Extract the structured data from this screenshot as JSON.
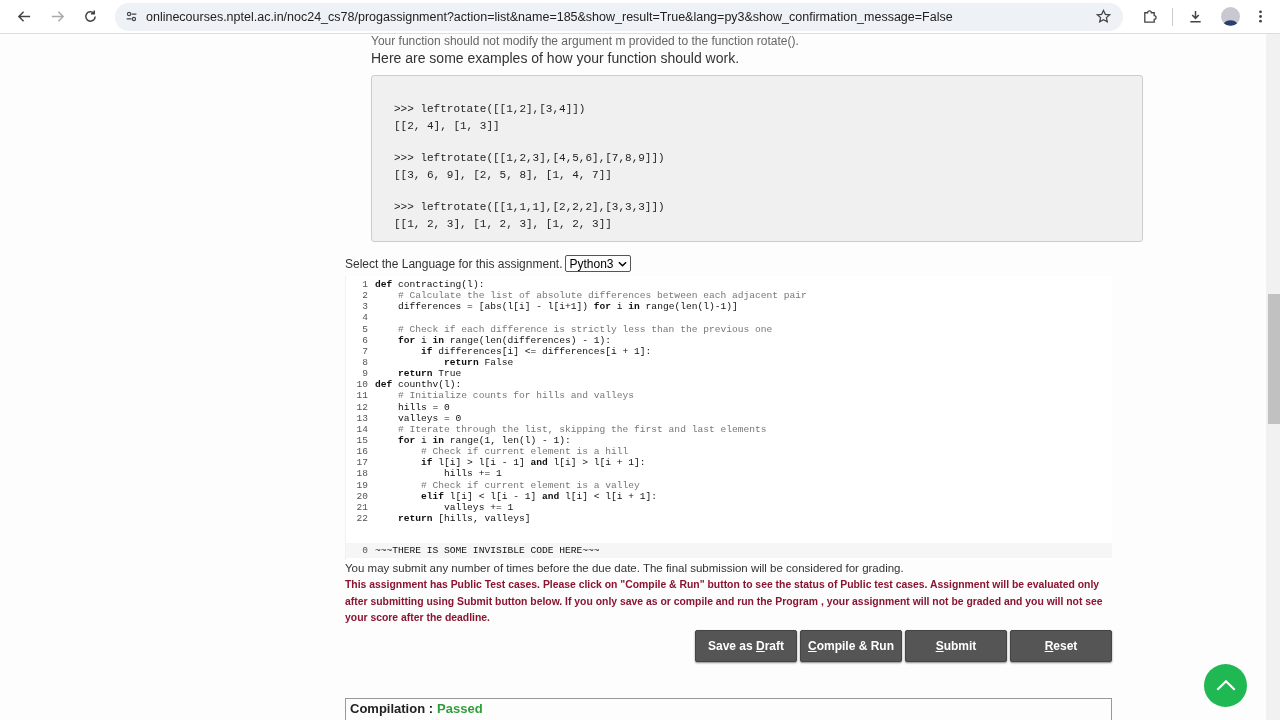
{
  "browser": {
    "url": "onlinecourses.nptel.ac.in/noc24_cs78/progassignment?action=list&name=185&show_result=True&lang=py3&show_confirmation_message=False"
  },
  "intro": "Your function should not modify the argument m provided to the function rotate().",
  "examples_heading": "Here are some examples of how your function should work.",
  "examples": [
    {
      "call": ">>> leftrotate([[1,2],[3,4]])",
      "result": "[[2, 4], [1, 3]]"
    },
    {
      "call": ">>> leftrotate([[1,2,3],[4,5,6],[7,8,9]])",
      "result": "[[3, 6, 9], [2, 5, 8], [1, 4, 7]]"
    },
    {
      "call": ">>> leftrotate([[1,1,1],[2,2,2],[3,3,3]])",
      "result": "[[1, 2, 3], [1, 2, 3], [1, 2, 3]]"
    }
  ],
  "language": {
    "label": "Select the Language for this assignment.",
    "value": "Python3"
  },
  "editor": {
    "lines": [
      {
        "number": "1",
        "kind": "code",
        "code": "**def** contracting(l):"
      },
      {
        "number": "2",
        "kind": "comment",
        "code": "    # Calculate the list of absolute differences between each adjacent pair"
      },
      {
        "number": "3",
        "kind": "code",
        "code": "    differences = [abs(l[i] - l[i+1]) **for** i **in** range(len(l)-1)]"
      },
      {
        "number": "4",
        "kind": "blank"
      },
      {
        "number": "5",
        "kind": "comment",
        "code": "    # Check if each difference is strictly less than the previous one"
      },
      {
        "number": "6",
        "kind": "code",
        "code": "    **for** i **in** range(len(differences) - 1):"
      },
      {
        "number": "7",
        "kind": "code",
        "code": "        **if** differences[i] <= differences[i + 1]:"
      },
      {
        "number": "8",
        "kind": "code",
        "code": "            **return** False"
      },
      {
        "number": "9",
        "kind": "code",
        "code": "    **return** True"
      },
      {
        "number": "10",
        "kind": "code",
        "code": "**def** counthv(l):"
      },
      {
        "number": "11",
        "kind": "comment",
        "code": "    # Initialize counts for hills and valleys"
      },
      {
        "number": "12",
        "kind": "code",
        "code": "    hills = 0"
      },
      {
        "number": "13",
        "kind": "code",
        "code": "    valleys = 0"
      },
      {
        "number": "14",
        "kind": "comment",
        "code": "    # Iterate through the list, skipping the first and last elements"
      },
      {
        "number": "15",
        "kind": "code",
        "code": "    **for** i **in** range(1, len(l) - 1):"
      },
      {
        "number": "16",
        "kind": "comment",
        "code": "        # Check if current element is a hill"
      },
      {
        "number": "17",
        "kind": "code",
        "code": "        **if** l[i] > l[i - 1] **and** l[i] > l[i + 1]:"
      },
      {
        "number": "18",
        "kind": "code",
        "code": "            hills += 1"
      },
      {
        "number": "19",
        "kind": "comment",
        "code": "        # Check if current element is a valley"
      },
      {
        "number": "20",
        "kind": "code",
        "code": "        **elif** l[i] < l[i - 1] **and** l[i] < l[i + 1]:"
      },
      {
        "number": "21",
        "kind": "code",
        "code": "            valleys += 1"
      },
      {
        "number": "22",
        "kind": "code",
        "code": "    **return** [hills, valleys]"
      }
    ],
    "hidden_line": {
      "number": "0",
      "code": "~~~THERE IS SOME INVISIBLE CODE HERE~~~"
    }
  },
  "notice": "You may submit any number of times before the due date. The final submission will be considered for grading.",
  "warning": "This assignment has Public Test cases. Please click on \"Compile & Run\" button to see the status of Public test cases. Assignment will be evaluated only after submitting using Submit button below. If you only save as or compile and run the Program , your assignment will not be graded and you will not see your score after the deadline.",
  "buttons": [
    {
      "before": "Save as ",
      "key": "D",
      "after": "raft"
    },
    {
      "key": "C",
      "after": "ompile & Run"
    },
    {
      "key": "S",
      "after": "ubmit"
    },
    {
      "key": "R",
      "after": "eset"
    }
  ],
  "compilation": {
    "label": "Compilation :",
    "status": "Passed"
  }
}
